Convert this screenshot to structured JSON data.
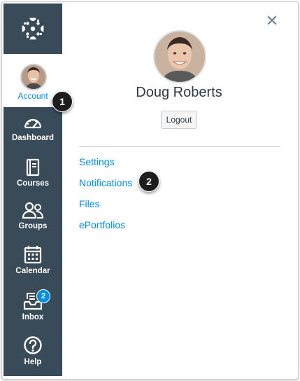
{
  "sidebar": {
    "account_label": "Account",
    "items": [
      {
        "label": "Dashboard",
        "icon": "dashboard-icon"
      },
      {
        "label": "Courses",
        "icon": "courses-icon"
      },
      {
        "label": "Groups",
        "icon": "groups-icon"
      },
      {
        "label": "Calendar",
        "icon": "calendar-icon"
      },
      {
        "label": "Inbox",
        "icon": "inbox-icon",
        "badge": "2"
      },
      {
        "label": "Help",
        "icon": "help-icon"
      }
    ]
  },
  "tray": {
    "close_symbol": "✕",
    "user_name": "Doug Roberts",
    "logout_label": "Logout",
    "links": [
      "Settings",
      "Notifications",
      "Files",
      "ePortfolios"
    ]
  },
  "callouts": [
    "1",
    "2"
  ],
  "colors": {
    "sidebar_bg": "#394b58",
    "link_blue": "#008ee2",
    "text_dark": "#2d3b45"
  }
}
